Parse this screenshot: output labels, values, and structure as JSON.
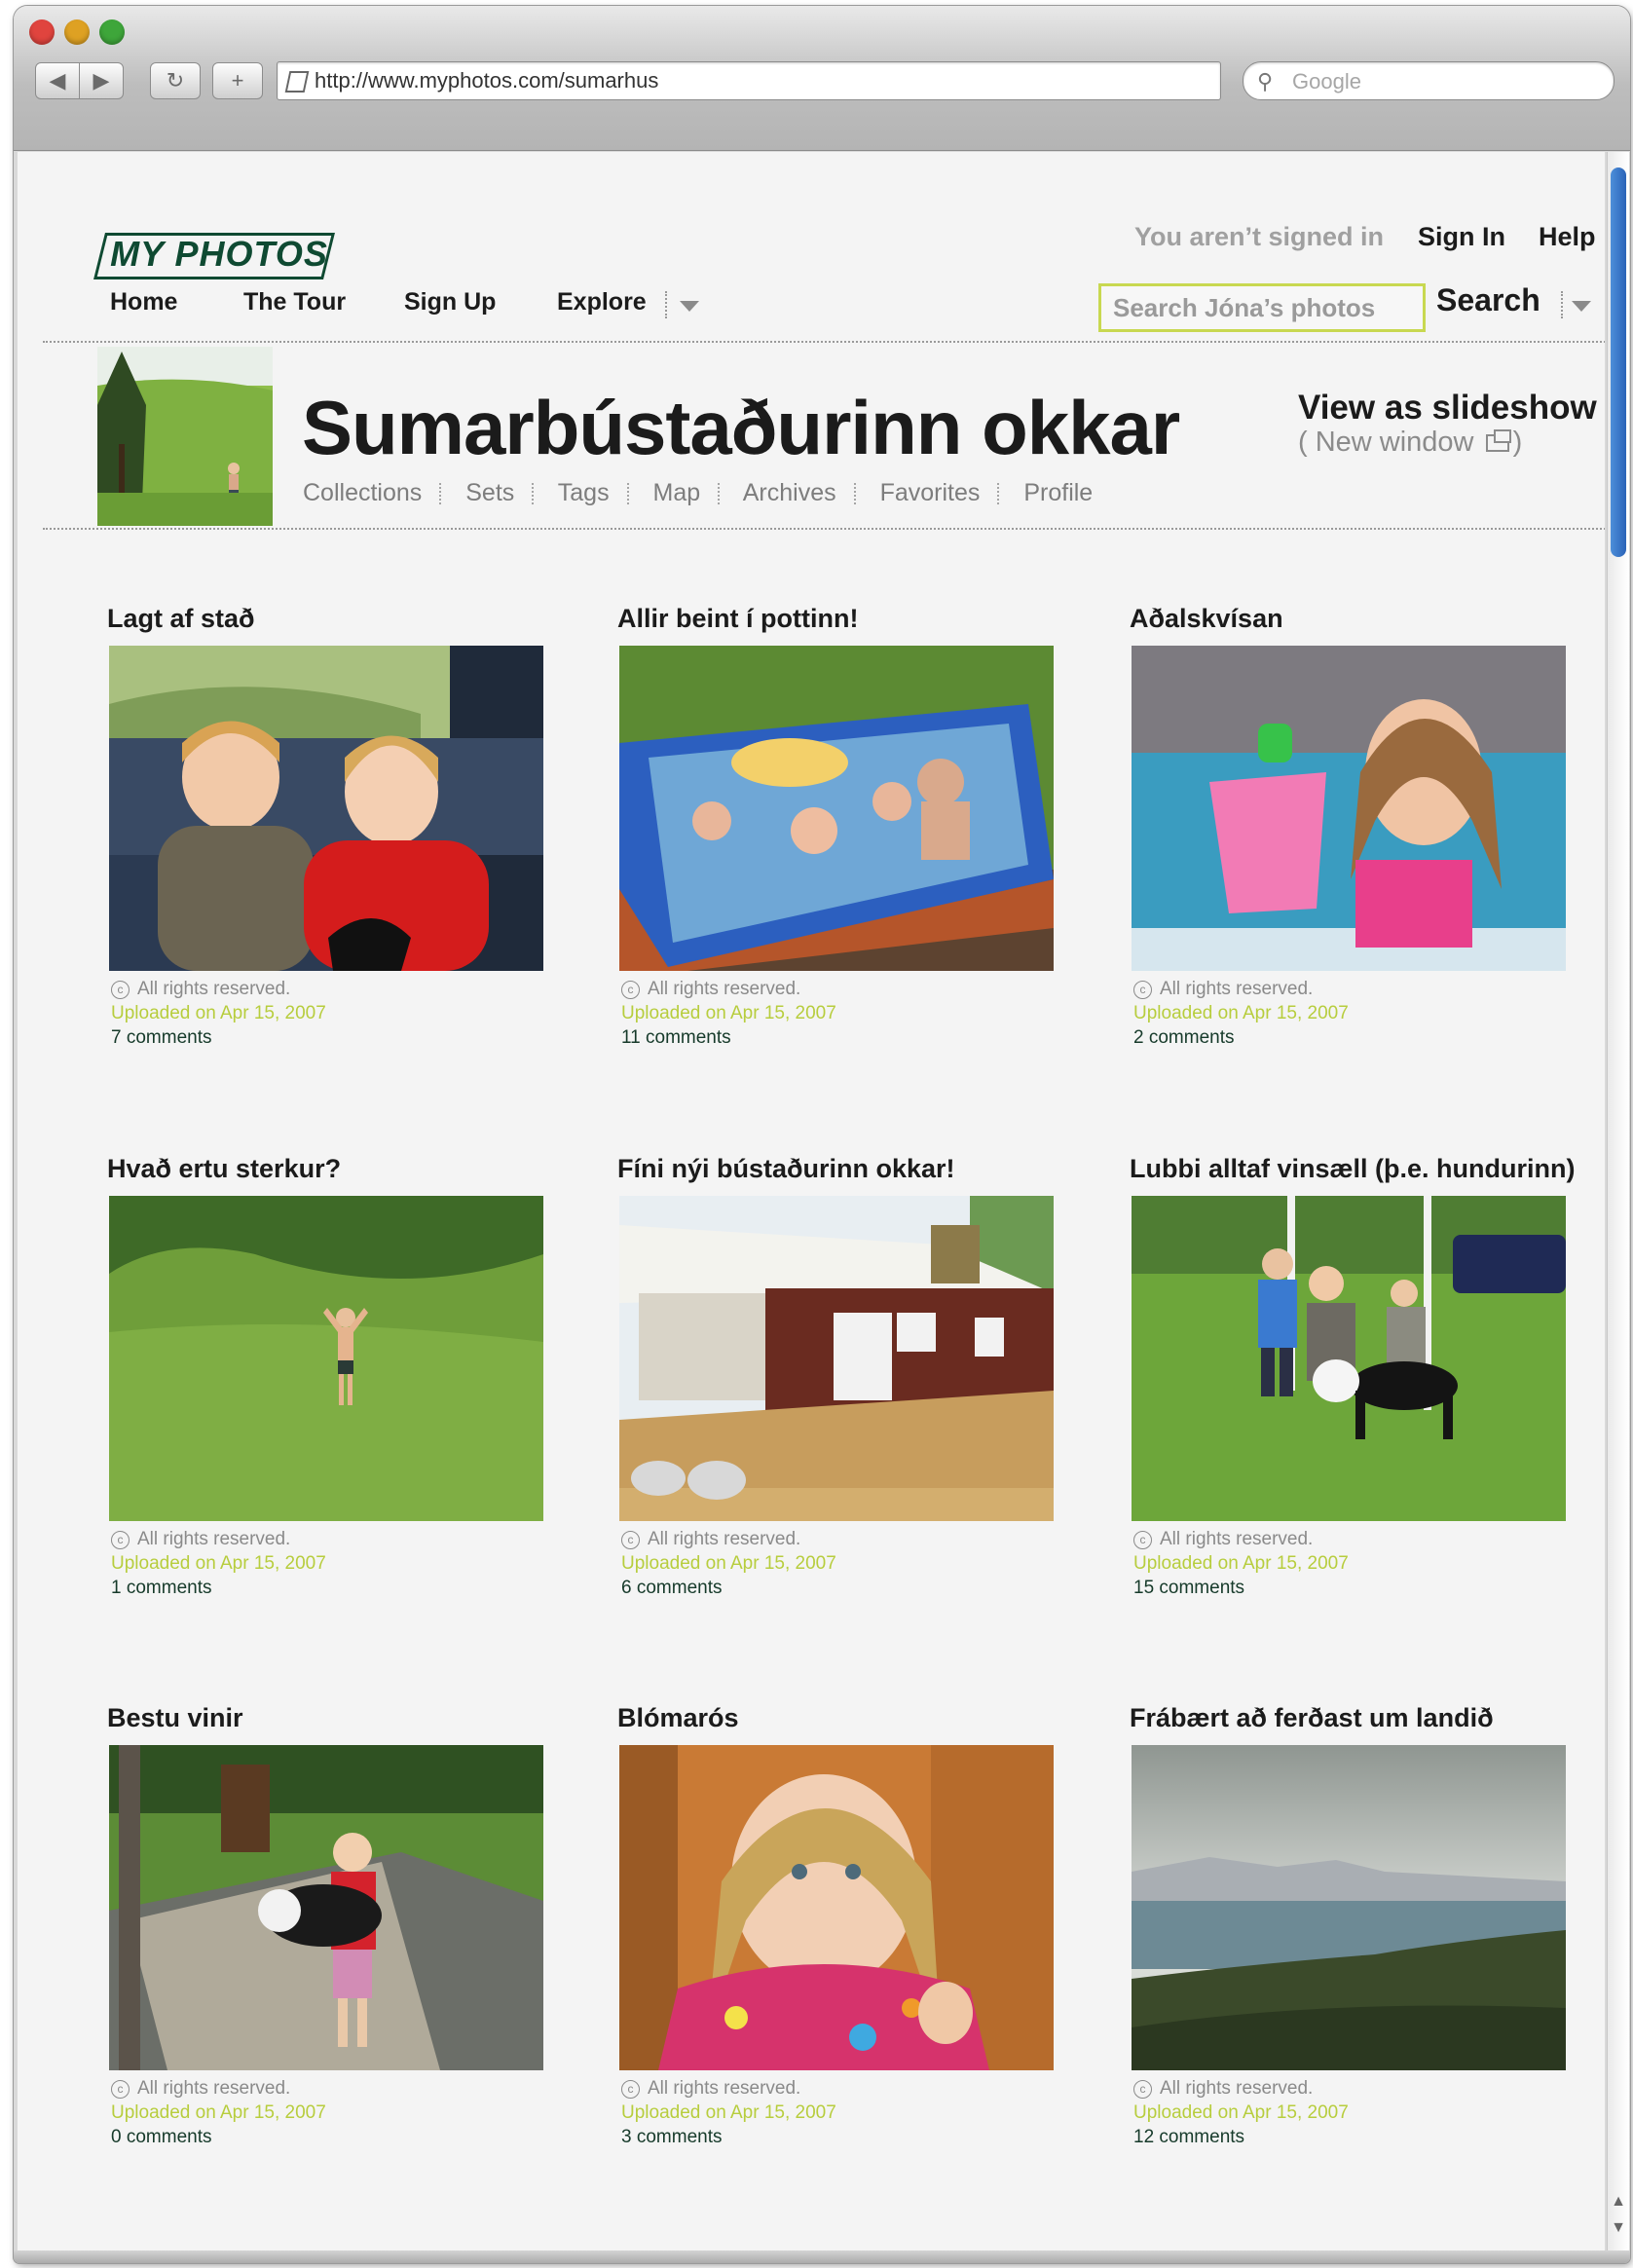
{
  "browser": {
    "url": "http://www.myphotos.com/sumarhus",
    "search_placeholder": "Google"
  },
  "site": {
    "logo": "MY PHOTOS",
    "nav": [
      "Home",
      "The Tour",
      "Sign Up",
      "Explore"
    ],
    "not_signed_in": "You aren’t signed in",
    "sign_in": "Sign In",
    "help": "Help",
    "search_placeholder": "Search Jóna’s photos",
    "search_button": "Search"
  },
  "album": {
    "title": "Sumarbústaðurinn okkar",
    "subnav": [
      "Collections",
      "Sets",
      "Tags",
      "Map",
      "Archives",
      "Favorites",
      "Profile"
    ],
    "slideshow": "View as slideshow",
    "new_window": "( New window",
    "new_window_close": ")"
  },
  "photos": [
    {
      "title": "Lagt af stað",
      "rights": "All rights reserved.",
      "uploaded": "Uploaded on Apr 15, 2007",
      "comments": "7 comments"
    },
    {
      "title": "Allir beint í pottinn!",
      "rights": "All rights reserved.",
      "uploaded": "Uploaded on Apr 15, 2007",
      "comments": "11 comments"
    },
    {
      "title": "Aðalskvísan",
      "rights": "All rights reserved.",
      "uploaded": "Uploaded on Apr 15, 2007",
      "comments": "2 comments"
    },
    {
      "title": "Hvað ertu sterkur?",
      "rights": "All rights reserved.",
      "uploaded": "Uploaded on Apr 15, 2007",
      "comments": "1 comments"
    },
    {
      "title": "Fíni nýi bústaðurinn okkar!",
      "rights": "All rights reserved.",
      "uploaded": "Uploaded on Apr 15, 2007",
      "comments": "6 comments"
    },
    {
      "title": "Lubbi alltaf vinsæll (þ.e. hundurinn)",
      "rights": "All rights reserved.",
      "uploaded": "Uploaded on Apr 15, 2007",
      "comments": "15 comments"
    },
    {
      "title": "Bestu vinir",
      "rights": "All rights reserved.",
      "uploaded": "Uploaded on Apr 15, 2007",
      "comments": "0 comments"
    },
    {
      "title": "Blómarós",
      "rights": "All rights reserved.",
      "uploaded": "Uploaded on Apr 15, 2007",
      "comments": "3 comments"
    },
    {
      "title": "Frábært að ferðast um landið",
      "rights": "All rights reserved.",
      "uploaded": "Uploaded on Apr 15, 2007",
      "comments": "12 comments"
    }
  ],
  "colors": {
    "brand_green": "#0f4a32",
    "upload_lime": "#b7cd3d",
    "search_border": "#c8d850"
  }
}
